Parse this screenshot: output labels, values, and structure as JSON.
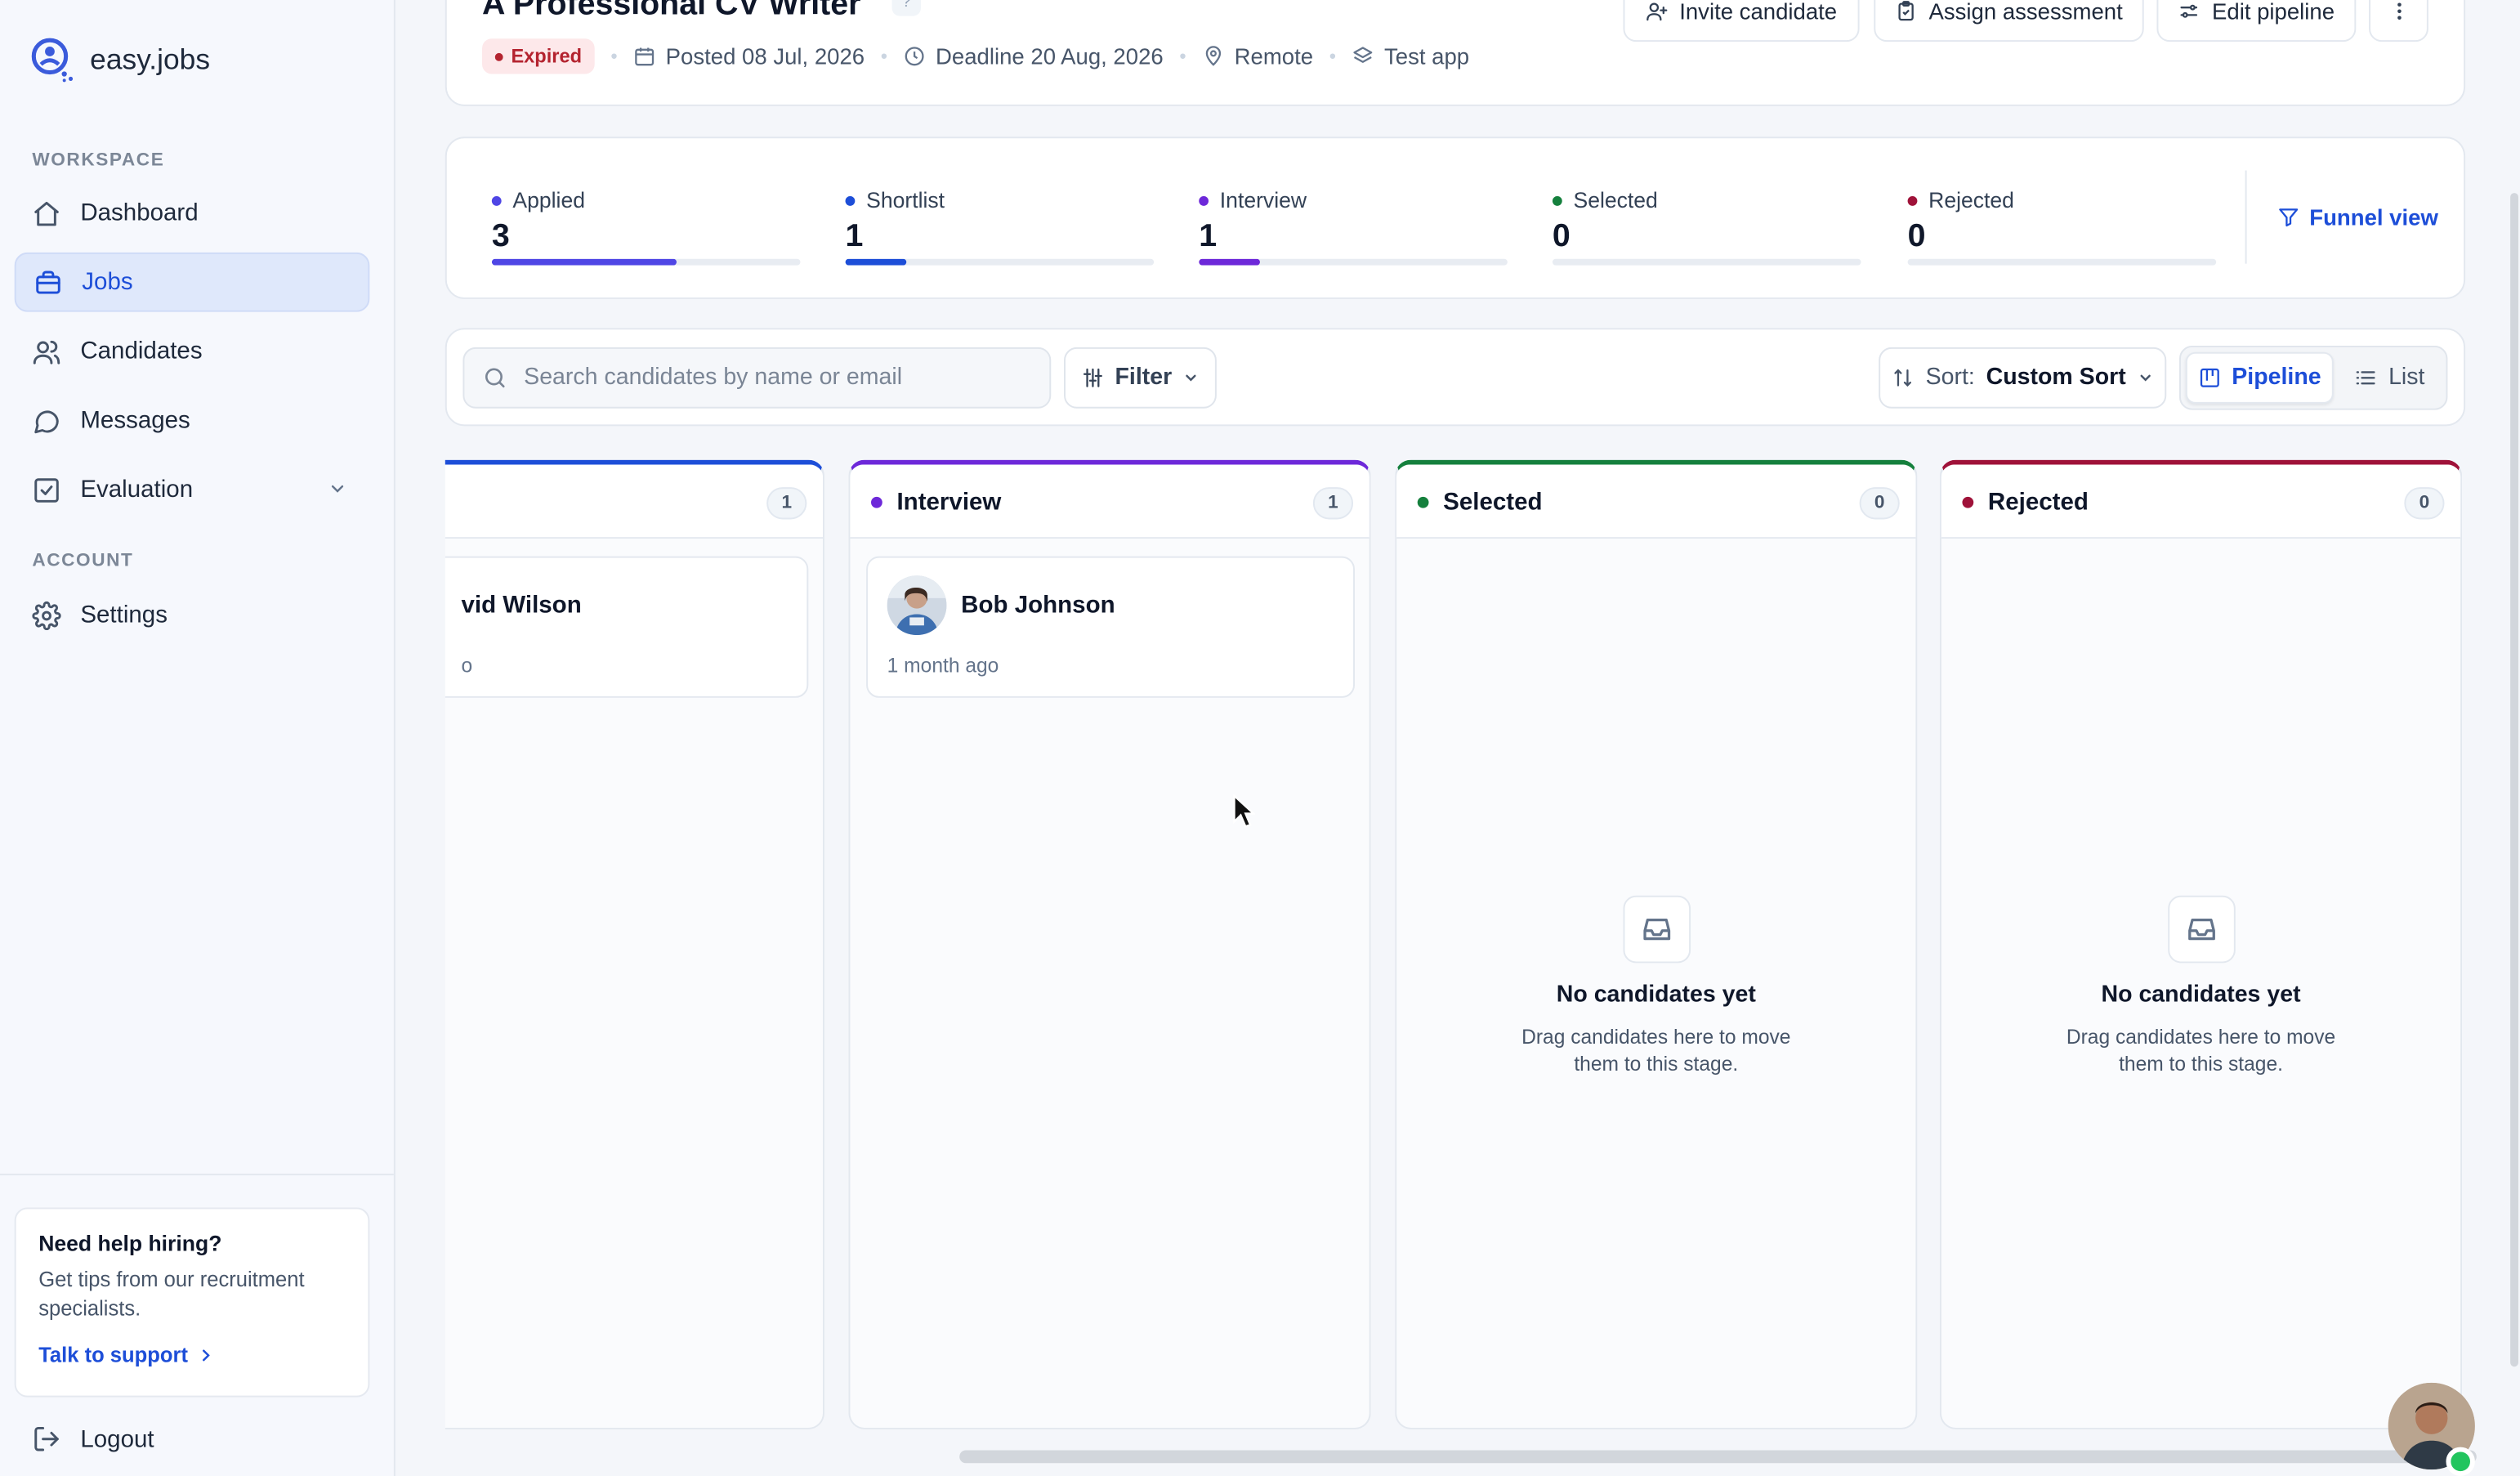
{
  "app": {
    "name": "easy.jobs"
  },
  "sidebar": {
    "workspace_label": "WORKSPACE",
    "account_label": "ACCOUNT",
    "items": [
      {
        "label": "Dashboard",
        "icon": "home-icon"
      },
      {
        "label": "Jobs",
        "icon": "briefcase-icon",
        "active": true
      },
      {
        "label": "Candidates",
        "icon": "users-icon"
      },
      {
        "label": "Messages",
        "icon": "chat-icon"
      },
      {
        "label": "Evaluation",
        "icon": "checklist-icon"
      }
    ],
    "settings_label": "Settings",
    "help": {
      "title": "Need help hiring?",
      "text": "Get tips from our recruitment specialists.",
      "link": "Talk to support"
    },
    "logout_label": "Logout"
  },
  "job": {
    "title": "A Professional CV Writer",
    "help_badge": "?",
    "status": "Expired",
    "posted": "Posted 08 Jul, 2026",
    "deadline": "Deadline 20 Aug, 2026",
    "location": "Remote",
    "app": "Test app"
  },
  "actions": {
    "invite": "Invite candidate",
    "assess": "Assign assessment",
    "edit": "Edit pipeline"
  },
  "stats": [
    {
      "label": "Applied",
      "value": "3",
      "color": "#4f46e5",
      "progress": 0.6
    },
    {
      "label": "Shortlist",
      "value": "1",
      "color": "#1d4ed8",
      "progress": 0.2
    },
    {
      "label": "Interview",
      "value": "1",
      "color": "#6d28d9",
      "progress": 0.2
    },
    {
      "label": "Selected",
      "value": "0",
      "color": "#15803d",
      "progress": 0
    },
    {
      "label": "Rejected",
      "value": "0",
      "color": "#9f1239",
      "progress": 0
    }
  ],
  "funnel_label": "Funnel view",
  "toolbar": {
    "search_placeholder": "Search candidates by name or email",
    "filter_label": "Filter",
    "sort_prefix": "Sort:",
    "sort_value": "Custom Sort",
    "view_pipeline": "Pipeline",
    "view_list": "List"
  },
  "columns": [
    {
      "title": "",
      "count": "1",
      "color": "#1d4ed8",
      "cards": [
        {
          "name": "vid Wilson",
          "time": "o"
        }
      ]
    },
    {
      "title": "Interview",
      "count": "1",
      "color": "#6d28d9",
      "cards": [
        {
          "name": "Bob Johnson",
          "time": "1 month ago"
        }
      ]
    },
    {
      "title": "Selected",
      "count": "0",
      "color": "#15803d",
      "empty_title": "No candidates yet",
      "empty_text": "Drag candidates here to move them to this stage."
    },
    {
      "title": "Rejected",
      "count": "0",
      "color": "#9f1239",
      "empty_title": "No candidates yet",
      "empty_text": "Drag candidates here to move them to this stage."
    }
  ]
}
